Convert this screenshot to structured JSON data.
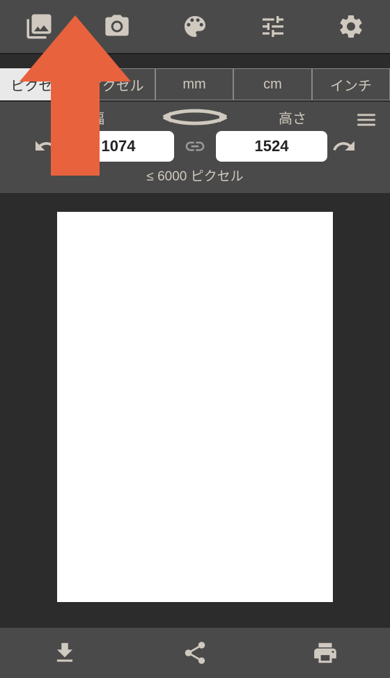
{
  "units": {
    "items": [
      "ピクセル",
      "ピクセル",
      "mm",
      "cm",
      "インチ"
    ],
    "active_index": 0
  },
  "size": {
    "width_label": "幅",
    "height_label": "高さ",
    "width_value": "1074",
    "height_value": "1524",
    "constraint": "≤ 6000 ピクセル"
  },
  "visible_width_fragment": "74"
}
